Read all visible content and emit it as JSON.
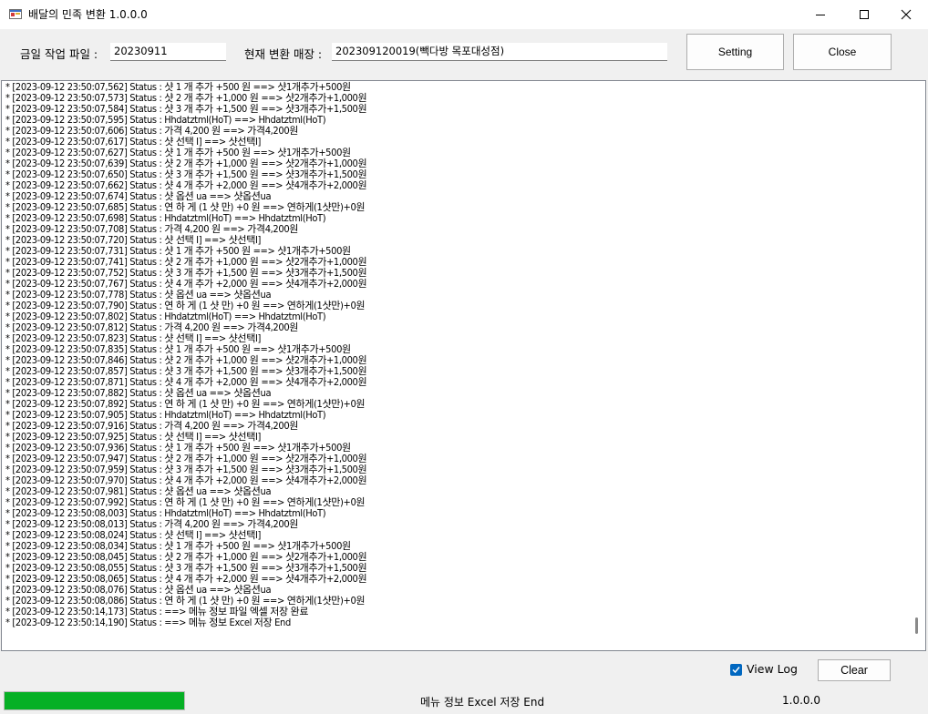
{
  "window": {
    "title": "배달의 민족 변환 1.0.0.0"
  },
  "toolbar": {
    "work_file_label": "금일 작업 파일 :",
    "work_file_value": "20230911",
    "store_label": "현재 변환 매장 :",
    "store_value": "202309120019(빽다방 목포대성점)",
    "setting_label": "Setting",
    "close_label": "Close"
  },
  "log": {
    "lines": [
      "* [2023-09-12 23:50:07,562] Status : 샷 1 개 추가 +500 원 ==> 샷1개추가+500원",
      "* [2023-09-12 23:50:07,573] Status : 샷 2 개 추가 +1,000 원 ==> 샷2개추가+1,000원",
      "* [2023-09-12 23:50:07,584] Status : 샷 3 개 추가 +1,500 원 ==> 샷3개추가+1,500원",
      "* [2023-09-12 23:50:07,595] Status : Hhdatztml(HoT) ==> Hhdatztml(HoT)",
      "* [2023-09-12 23:50:07,606] Status : 가격 4,200 원 ==> 가격4,200원",
      "* [2023-09-12 23:50:07,617] Status : 샷 선택 I] ==> 샷선택I]",
      "* [2023-09-12 23:50:07,627] Status : 샷 1 개 추가 +500 원 ==> 샷1개추가+500원",
      "* [2023-09-12 23:50:07,639] Status : 샷 2 개 추가 +1,000 원 ==> 샷2개추가+1,000원",
      "* [2023-09-12 23:50:07,650] Status : 샷 3 개 추가 +1,500 원 ==> 샷3개추가+1,500원",
      "* [2023-09-12 23:50:07,662] Status : 샷 4 개 추가 +2,000 원 ==> 샷4개추가+2,000원",
      "* [2023-09-12 23:50:07,674] Status : 샷 옵션 ua ==> 샷옵션ua",
      "* [2023-09-12 23:50:07,685] Status : 연 하 게 (1 샷 만) +0 원 ==> 연하게(1샷만)+0원",
      "* [2023-09-12 23:50:07,698] Status : Hhdatztml(HoT) ==> Hhdatztml(HoT)",
      "* [2023-09-12 23:50:07,708] Status : 가격 4,200 원 ==> 가격4,200원",
      "* [2023-09-12 23:50:07,720] Status : 샷 선택 I] ==> 샷선택I]",
      "* [2023-09-12 23:50:07,731] Status : 샷 1 개 추가 +500 원 ==> 샷1개추가+500원",
      "* [2023-09-12 23:50:07,741] Status : 샷 2 개 추가 +1,000 원 ==> 샷2개추가+1,000원",
      "* [2023-09-12 23:50:07,752] Status : 샷 3 개 추가 +1,500 원 ==> 샷3개추가+1,500원",
      "* [2023-09-12 23:50:07,767] Status : 샷 4 개 추가 +2,000 원 ==> 샷4개추가+2,000원",
      "* [2023-09-12 23:50:07,778] Status : 샷 옵션 ua ==> 샷옵션ua",
      "* [2023-09-12 23:50:07,790] Status : 연 하 게 (1 샷 만) +0 원 ==> 연하게(1샷만)+0원",
      "* [2023-09-12 23:50:07,802] Status : Hhdatztml(HoT) ==> Hhdatztml(HoT)",
      "* [2023-09-12 23:50:07,812] Status : 가격 4,200 원 ==> 가격4,200원",
      "* [2023-09-12 23:50:07,823] Status : 샷 선택 I] ==> 샷선택I]",
      "* [2023-09-12 23:50:07,835] Status : 샷 1 개 추가 +500 원 ==> 샷1개추가+500원",
      "* [2023-09-12 23:50:07,846] Status : 샷 2 개 추가 +1,000 원 ==> 샷2개추가+1,000원",
      "* [2023-09-12 23:50:07,857] Status : 샷 3 개 추가 +1,500 원 ==> 샷3개추가+1,500원",
      "* [2023-09-12 23:50:07,871] Status : 샷 4 개 추가 +2,000 원 ==> 샷4개추가+2,000원",
      "* [2023-09-12 23:50:07,882] Status : 샷 옵션 ua ==> 샷옵션ua",
      "* [2023-09-12 23:50:07,892] Status : 연 하 게 (1 샷 만) +0 원 ==> 연하게(1샷만)+0원",
      "* [2023-09-12 23:50:07,905] Status : Hhdatztml(HoT) ==> Hhdatztml(HoT)",
      "* [2023-09-12 23:50:07,916] Status : 가격 4,200 원 ==> 가격4,200원",
      "* [2023-09-12 23:50:07,925] Status : 샷 선택 I] ==> 샷선택I]",
      "* [2023-09-12 23:50:07,936] Status : 샷 1 개 추가 +500 원 ==> 샷1개추가+500원",
      "* [2023-09-12 23:50:07,947] Status : 샷 2 개 추가 +1,000 원 ==> 샷2개추가+1,000원",
      "* [2023-09-12 23:50:07,959] Status : 샷 3 개 추가 +1,500 원 ==> 샷3개추가+1,500원",
      "* [2023-09-12 23:50:07,970] Status : 샷 4 개 추가 +2,000 원 ==> 샷4개추가+2,000원",
      "* [2023-09-12 23:50:07,981] Status : 샷 옵션 ua ==> 샷옵션ua",
      "* [2023-09-12 23:50:07,992] Status : 연 하 게 (1 샷 만) +0 원 ==> 연하게(1샷만)+0원",
      "* [2023-09-12 23:50:08,003] Status : Hhdatztml(HoT) ==> Hhdatztml(HoT)",
      "* [2023-09-12 23:50:08,013] Status : 가격 4,200 원 ==> 가격4,200원",
      "* [2023-09-12 23:50:08,024] Status : 샷 선택 I] ==> 샷선택I]",
      "* [2023-09-12 23:50:08,034] Status : 샷 1 개 추가 +500 원 ==> 샷1개추가+500원",
      "* [2023-09-12 23:50:08,045] Status : 샷 2 개 추가 +1,000 원 ==> 샷2개추가+1,000원",
      "* [2023-09-12 23:50:08,055] Status : 샷 3 개 추가 +1,500 원 ==> 샷3개추가+1,500원",
      "* [2023-09-12 23:50:08,065] Status : 샷 4 개 추가 +2,000 원 ==> 샷4개추가+2,000원",
      "* [2023-09-12 23:50:08,076] Status : 샷 옵션 ua ==> 샷옵션ua",
      "* [2023-09-12 23:50:08,086] Status : 연 하 게 (1 샷 만) +0 원 ==> 연하게(1샷만)+0원",
      "* [2023-09-12 23:50:14,173] Status : ==> 메뉴 정보 파일 엑셀 저장 완료",
      "* [2023-09-12 23:50:14,190] Status : ==> 메뉴 정보 Excel 저장 End"
    ]
  },
  "controls": {
    "view_log_label": "View Log",
    "view_log_checked": true,
    "clear_label": "Clear"
  },
  "statusbar": {
    "progress_fraction": 1.0,
    "progress_color": "#06b025",
    "message": "메뉴 정보 Excel 저장 End",
    "version": "1.0.0.0"
  }
}
